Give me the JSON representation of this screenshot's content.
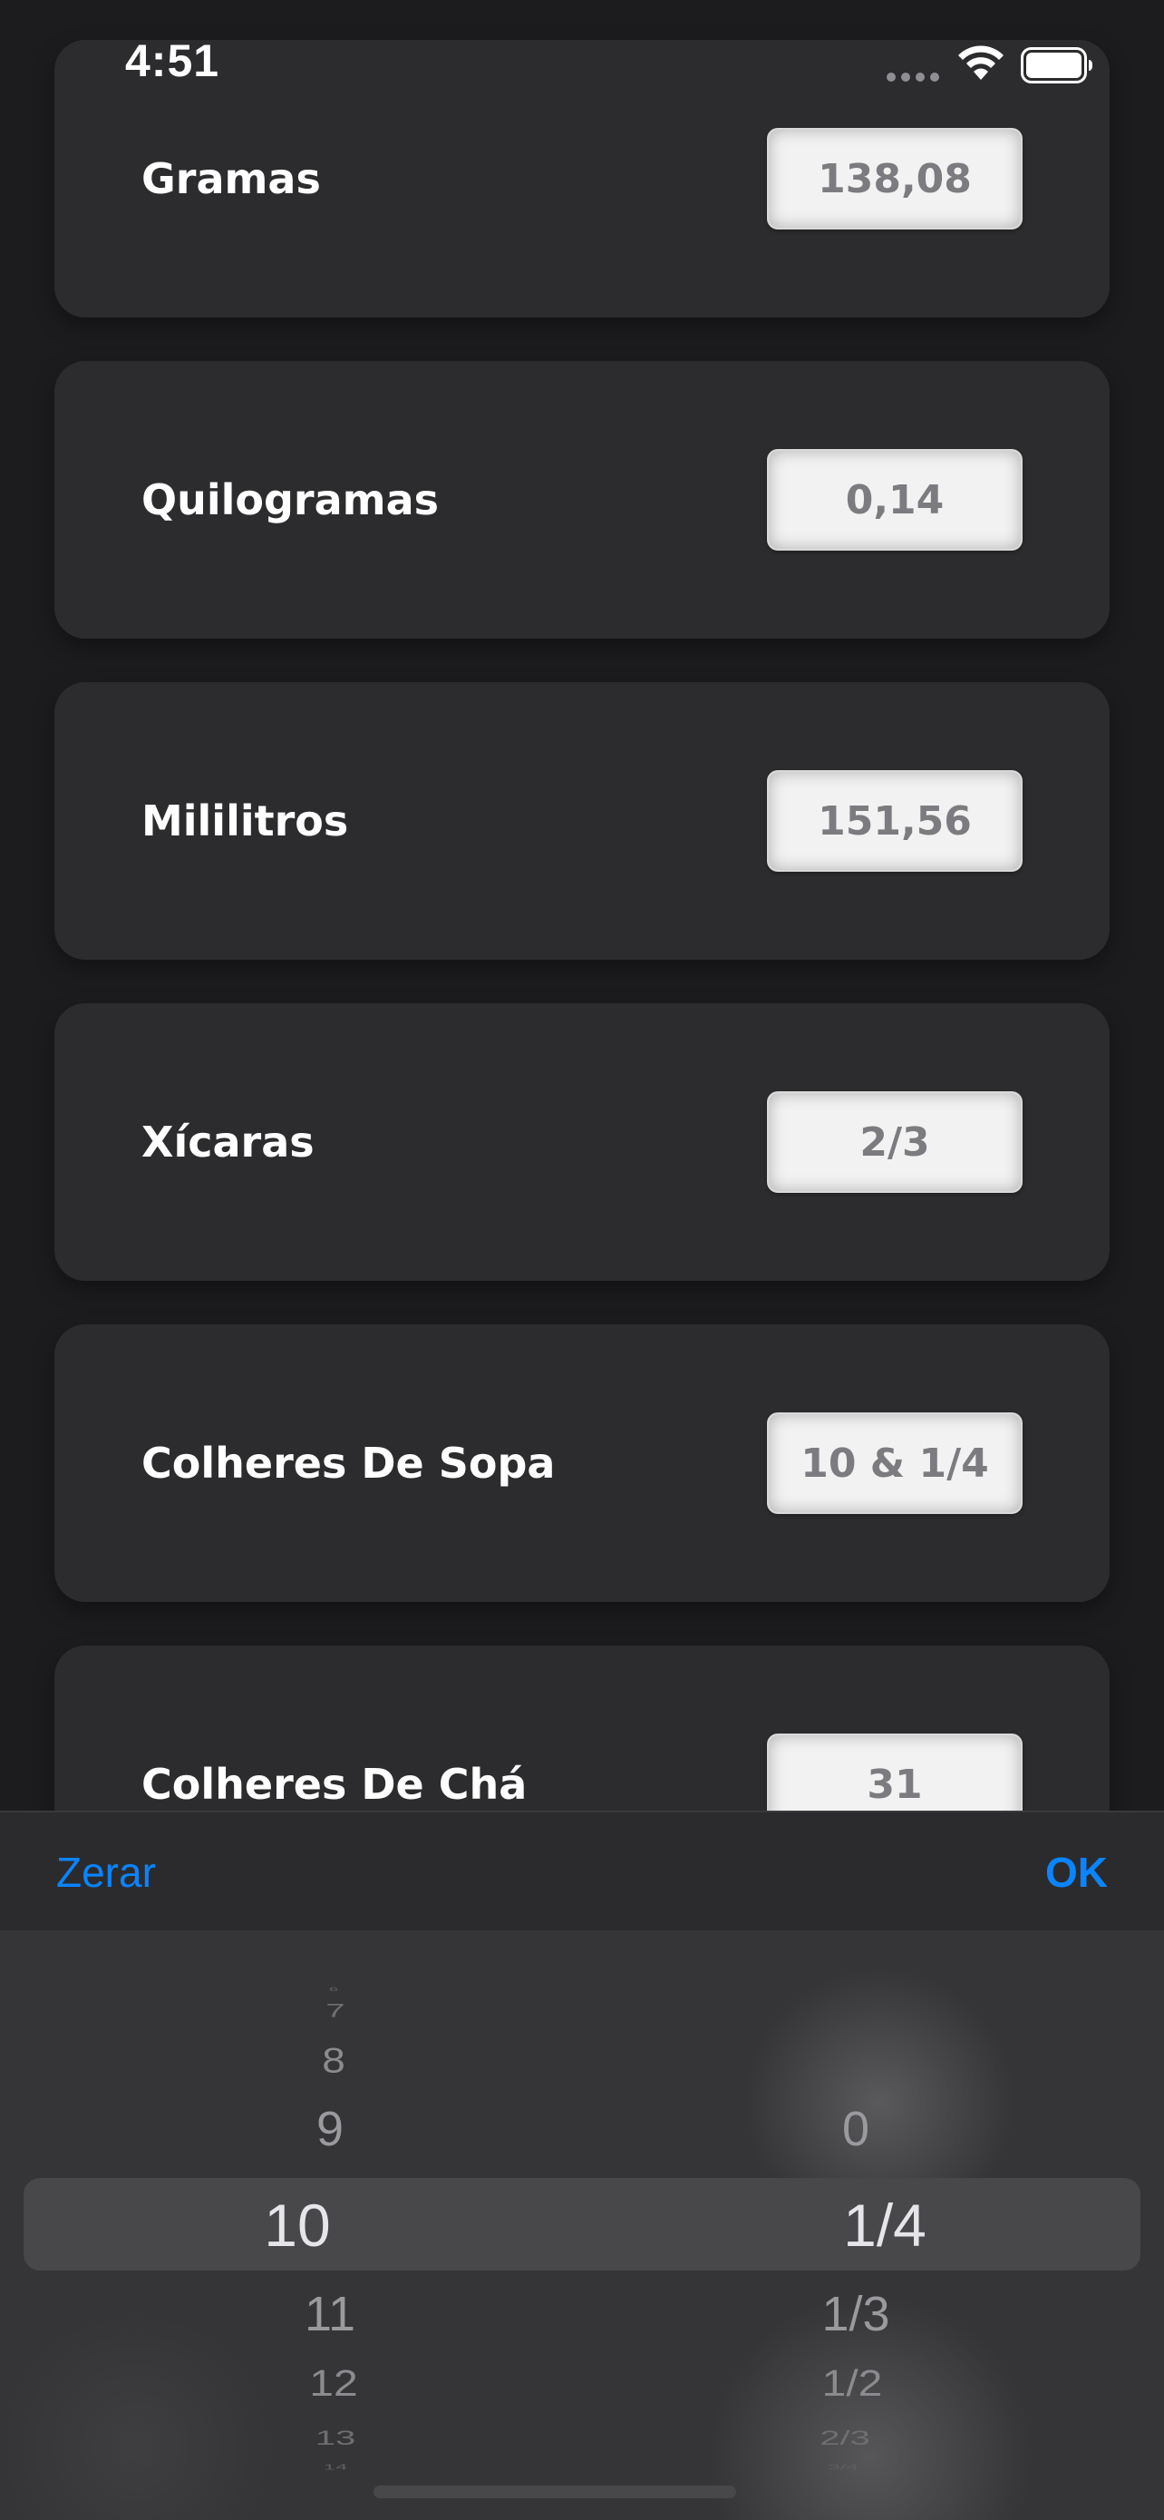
{
  "status_bar": {
    "time": "4:51"
  },
  "conversions": [
    {
      "label": "Gramas",
      "value": "138,08"
    },
    {
      "label": "Quilogramas",
      "value": "0,14"
    },
    {
      "label": "Mililitros",
      "value": "151,56"
    },
    {
      "label": "Xícaras",
      "value": "2/3"
    },
    {
      "label": "Colheres De Sopa",
      "value": "10 & 1/4"
    },
    {
      "label": "Colheres De Chá",
      "value": "31"
    }
  ],
  "toolbar": {
    "reset_label": "Zerar",
    "done_label": "OK",
    "accent_color": "#0a84ff"
  },
  "picker": {
    "whole_column": {
      "items": [
        "6",
        "7",
        "8",
        "9",
        "10",
        "11",
        "12",
        "13",
        "14"
      ],
      "selected": "10"
    },
    "fraction_column": {
      "items": [
        "0",
        "1/4",
        "1/3",
        "1/2",
        "2/3",
        "3/4"
      ],
      "selected": "1/4"
    }
  }
}
